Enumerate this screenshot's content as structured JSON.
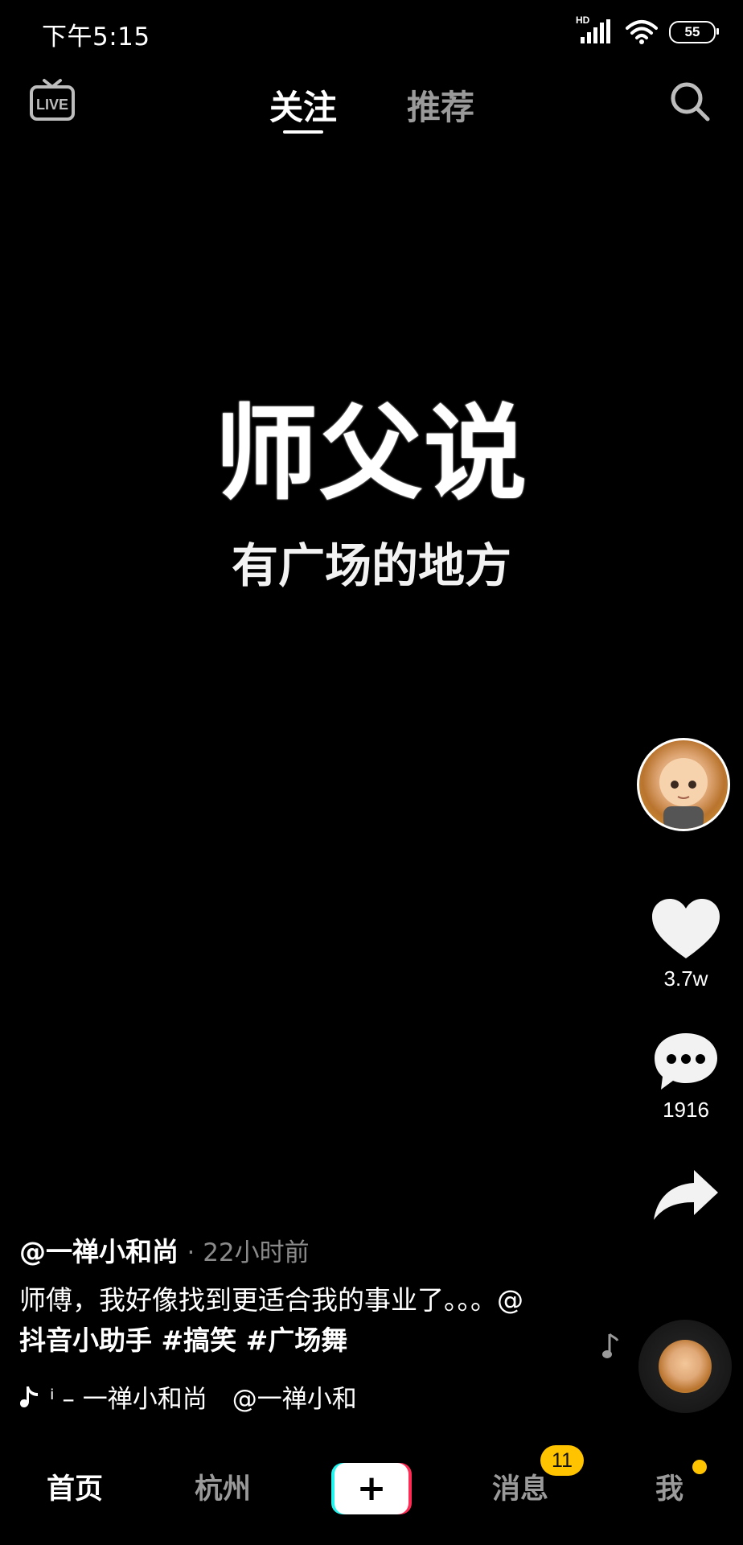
{
  "status_bar": {
    "time": "下午5:15",
    "network_label": "HD",
    "battery": "55"
  },
  "top_nav": {
    "live_icon": "live-tv-icon",
    "tabs": [
      {
        "label": "关注",
        "active": true
      },
      {
        "label": "推荐",
        "active": false
      }
    ],
    "search_icon": "search-icon"
  },
  "video": {
    "title": "师父说",
    "subtitle": "有广场的地方"
  },
  "actions": {
    "like": {
      "icon": "heart-icon",
      "count": "3.7w"
    },
    "comment": {
      "icon": "comment-icon",
      "count": "1916"
    },
    "share": {
      "icon": "share-arrow-icon"
    }
  },
  "caption": {
    "author": "@一禅小和尚",
    "time_ago": "· 22小时前",
    "description": "师傅，我好像找到更适合我的事业了。。。@",
    "tags_line": "抖音小助手 #搞笑 #广场舞",
    "music": "ⁱ – 一禅小和尚　@一禅小和"
  },
  "tab_bar": {
    "home": "首页",
    "city": "杭州",
    "plus": "+",
    "messages": "消息",
    "messages_badge": "11",
    "me": "我"
  },
  "colors": {
    "background": "#000000",
    "inactive": "#9a9a9a",
    "badge": "#ffc300",
    "cyan": "#25f4ee",
    "red": "#fe2c55"
  }
}
